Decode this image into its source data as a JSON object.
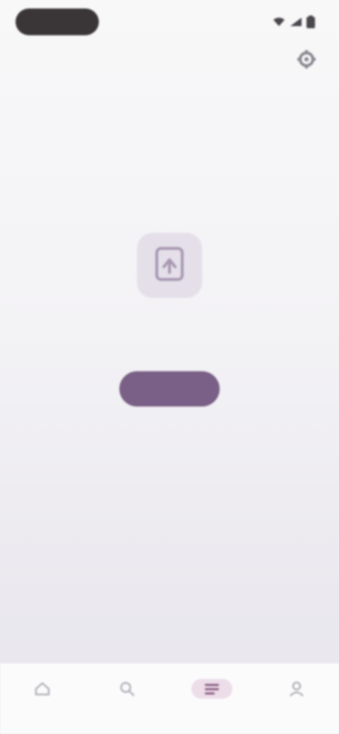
{
  "status_bar": {
    "time": "",
    "icons": [
      "wifi-icon",
      "signal-icon",
      "battery-icon"
    ]
  },
  "header": {
    "title": "",
    "action_icon": "settings-icon"
  },
  "empty_state": {
    "icon": "document-icon",
    "title": "",
    "subtitle": "",
    "button_label": ""
  },
  "bottom_nav": {
    "items": [
      {
        "icon": "home-icon",
        "label": ""
      },
      {
        "icon": "search-icon",
        "label": ""
      },
      {
        "icon": "list-icon",
        "label": ""
      },
      {
        "icon": "person-icon",
        "label": ""
      }
    ],
    "active_index": 2
  },
  "colors": {
    "accent": "#7a5f86",
    "accent_soft": "#e4dfe9",
    "active_nav_bg": "#ecdde9",
    "background": "#f3f2f5"
  }
}
